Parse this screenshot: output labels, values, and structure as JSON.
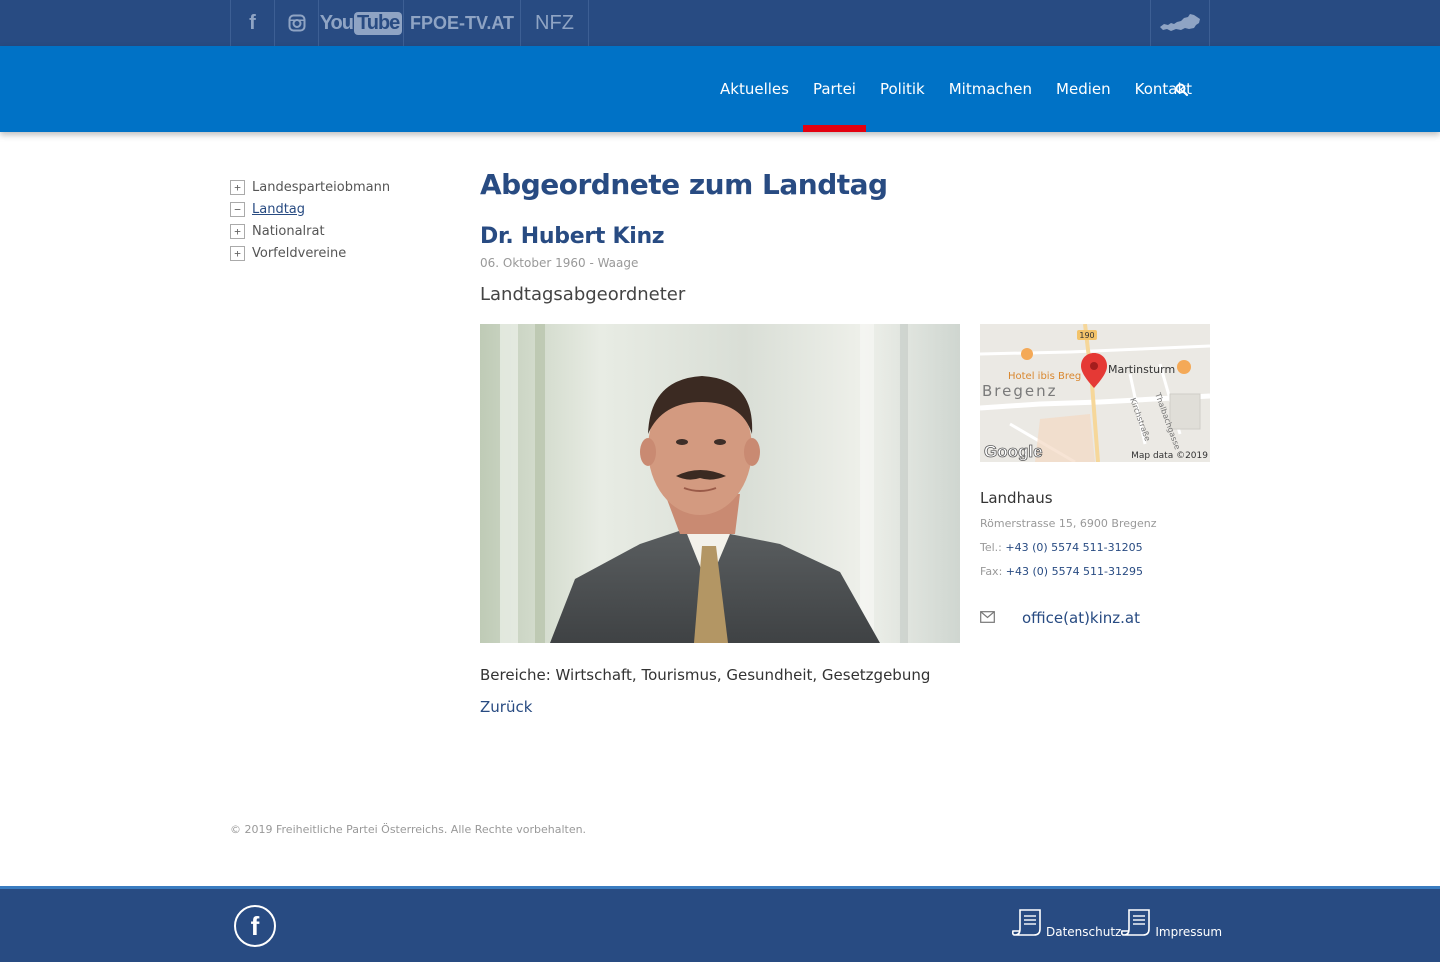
{
  "topbar": {
    "social": {
      "facebook_glyph": "f",
      "youtube_you": "You",
      "youtube_tube": "Tube",
      "fpoe_tv": "FPOE-TV.AT",
      "nfz": "NFZ"
    },
    "colors": {
      "background": "#284b82",
      "icon": "#8fa4c4"
    }
  },
  "nav": {
    "items": [
      {
        "label": "Aktuelles"
      },
      {
        "label": "Partei",
        "active": true
      },
      {
        "label": "Politik"
      },
      {
        "label": "Mitmachen"
      },
      {
        "label": "Medien"
      },
      {
        "label": "Kontakt"
      }
    ],
    "search_icon": "search-icon",
    "colors": {
      "background": "#0072c6",
      "active_indicator": "#e3000f"
    }
  },
  "sidebar": {
    "items": [
      {
        "toggle": "+",
        "label": "Landesparteiobmann"
      },
      {
        "toggle": "−",
        "label": "Landtag",
        "active": true
      },
      {
        "toggle": "+",
        "label": "Nationalrat"
      },
      {
        "toggle": "+",
        "label": "Vorfeldvereine"
      }
    ]
  },
  "main": {
    "title": "Abgeordnete zum Landtag",
    "person": {
      "name": "Dr. Hubert Kinz",
      "meta": "06. Oktober 1960 - Waage",
      "role": "Landtagsabgeordneter"
    },
    "map": {
      "road_badge": "190",
      "place_hotel": "Hotel ibis Breg",
      "place_tower": "Martinsturm",
      "city": "Bregenz",
      "street_1": "Kirchstraße",
      "street_2": "Thalbachgasse",
      "logo": "Google",
      "attribution": "Map data ©2019"
    },
    "address": {
      "title": "Landhaus",
      "street": "Römerstrasse 15, 6900 Bregenz",
      "tel_label": "Tel.:",
      "tel_value": "+43 (0) 5574 511-31205",
      "fax_label": "Fax:",
      "fax_value": "+43 (0) 5574 511-31295",
      "email": "office(at)kinz.at"
    },
    "bereiche": "Bereiche: Wirtschaft, Tourismus, Gesundheit, Gesetzgebung",
    "back": "Zurück"
  },
  "copyright": "© 2019 Freiheitliche Partei Österreichs. Alle Rechte vorbehalten.",
  "footer": {
    "facebook_glyph": "f",
    "datenschutz": "Datenschutz",
    "impressum": "Impressum"
  }
}
